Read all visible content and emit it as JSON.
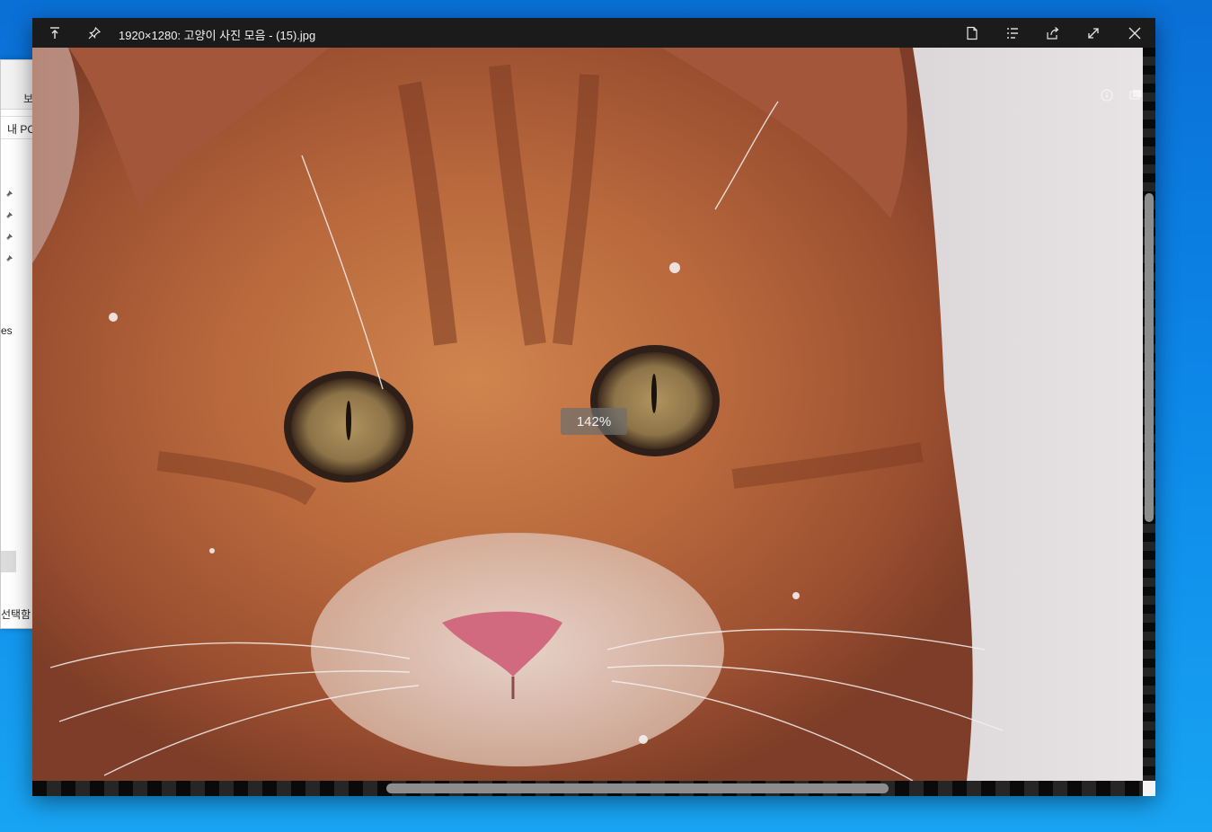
{
  "desktop": {
    "background": "#0c86e8"
  },
  "explorer": {
    "ribbon_tab": "보",
    "address": "내 PC",
    "sidebar_label": "es",
    "status": "선택함"
  },
  "viewer": {
    "title": "1920×1280: 고양이 사진 모음 - (15).jpg",
    "zoom": "142%",
    "buttons": {
      "up": "move-up-icon",
      "pin": "pin-icon",
      "file": "file-icon",
      "list": "list-icon",
      "share": "share-icon",
      "fullscreen": "fullscreen-icon",
      "close": "close-icon"
    },
    "image": {
      "subject": "orange tabby kitten face",
      "accent": "#c06a3a"
    },
    "scroll": {
      "horizontal": 0.45,
      "vertical": 0.45
    }
  }
}
